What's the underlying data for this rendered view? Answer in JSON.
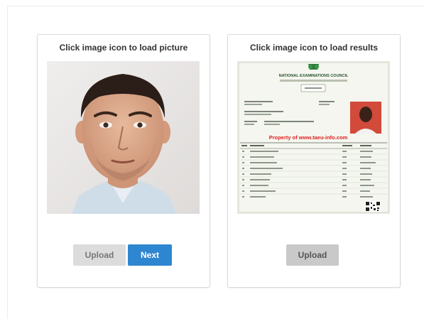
{
  "picture_card": {
    "title": "Click image icon to load picture",
    "upload_label": "Upload",
    "next_label": "Next"
  },
  "results_card": {
    "title": "Click image icon to load results",
    "upload_label": "Upload",
    "certificate": {
      "heading": "NATIONAL EXAMINATIONS COUNCIL",
      "watermark": "Property of www.taeu-info.com"
    }
  },
  "colors": {
    "primary": "#2f86d0",
    "upload_button": "#dcdcdc",
    "watermark": "#e02020"
  }
}
